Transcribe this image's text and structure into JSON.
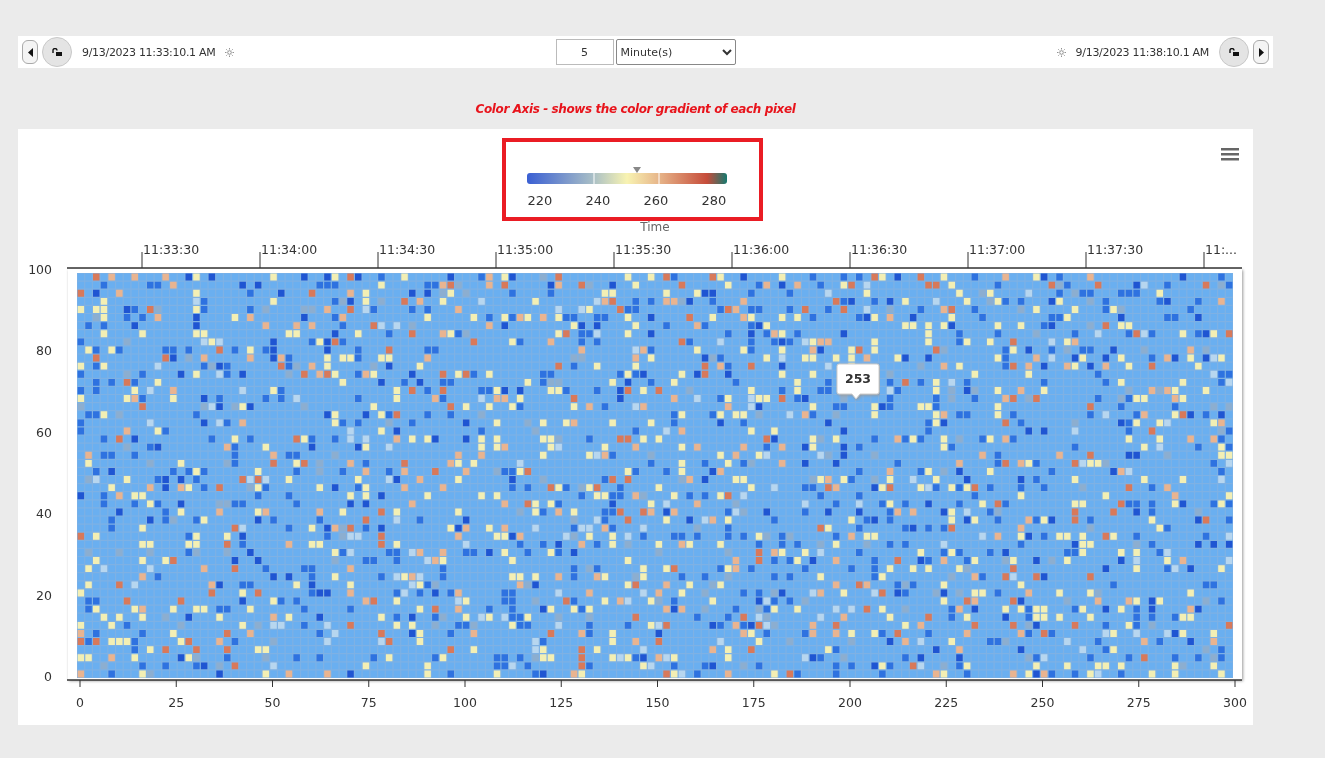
{
  "toolbar": {
    "start_time": "9/13/2023 11:33:10.1 AM",
    "end_time": "9/13/2023 11:38:10.1 AM",
    "duration": "5",
    "unit": "Minute(s)"
  },
  "caption": "Color Axis - shows the color gradient of each pixel",
  "chart": {
    "legend": {
      "labels": [
        "220",
        "240",
        "260",
        "280"
      ],
      "level": 0.55
    },
    "x_title": "Time",
    "time_ticks": [
      "11:33:30",
      "11:34:00",
      "11:34:30",
      "11:35:00",
      "11:35:30",
      "11:36:00",
      "11:36:30",
      "11:37:00",
      "11:37:30",
      "11:..."
    ],
    "y_ticks": [
      "100",
      "80",
      "60",
      "40",
      "20",
      "0"
    ],
    "x_ticks": [
      "0",
      "25",
      "50",
      "75",
      "100",
      "125",
      "150",
      "175",
      "200",
      "225",
      "250",
      "275",
      "300"
    ],
    "tooltip": "253"
  }
}
